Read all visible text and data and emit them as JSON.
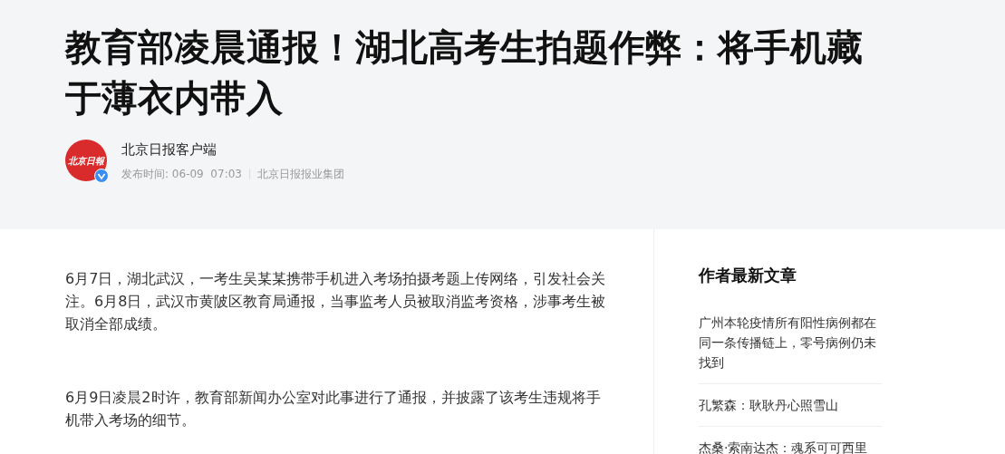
{
  "article": {
    "title": "教育部凌晨通报！湖北高考生拍题作弊：将手机藏于薄衣内带入",
    "author": {
      "avatar_text": "北京日報",
      "verified": true,
      "name": "北京日报客户端",
      "publish_time": "发布时间: 06-09  07:03",
      "organization": "北京日报报业集团"
    },
    "paragraphs": [
      "6月7日，湖北武汉，一考生吴某某携带手机进入考场拍摄考题上传网络，引发社会关注。6月8日，武汉市黄陂区教育局通报，当事监考人员被取消监考资格，涉事考生被取消全部成绩。",
      "6月9日凌晨2时许，教育部新闻办公室对此事进行了通报，并披露了该考生违规将手机带入考场的细节。"
    ]
  },
  "sidebar": {
    "heading": "作者最新文章",
    "articles": [
      "广州本轮疫情所有阳性病例都在同一条传播链上，零号病例仍未找到",
      "孔繁森：耿耿丹心照雪山",
      "杰桑·索南达杰：魂系可可西里"
    ]
  }
}
